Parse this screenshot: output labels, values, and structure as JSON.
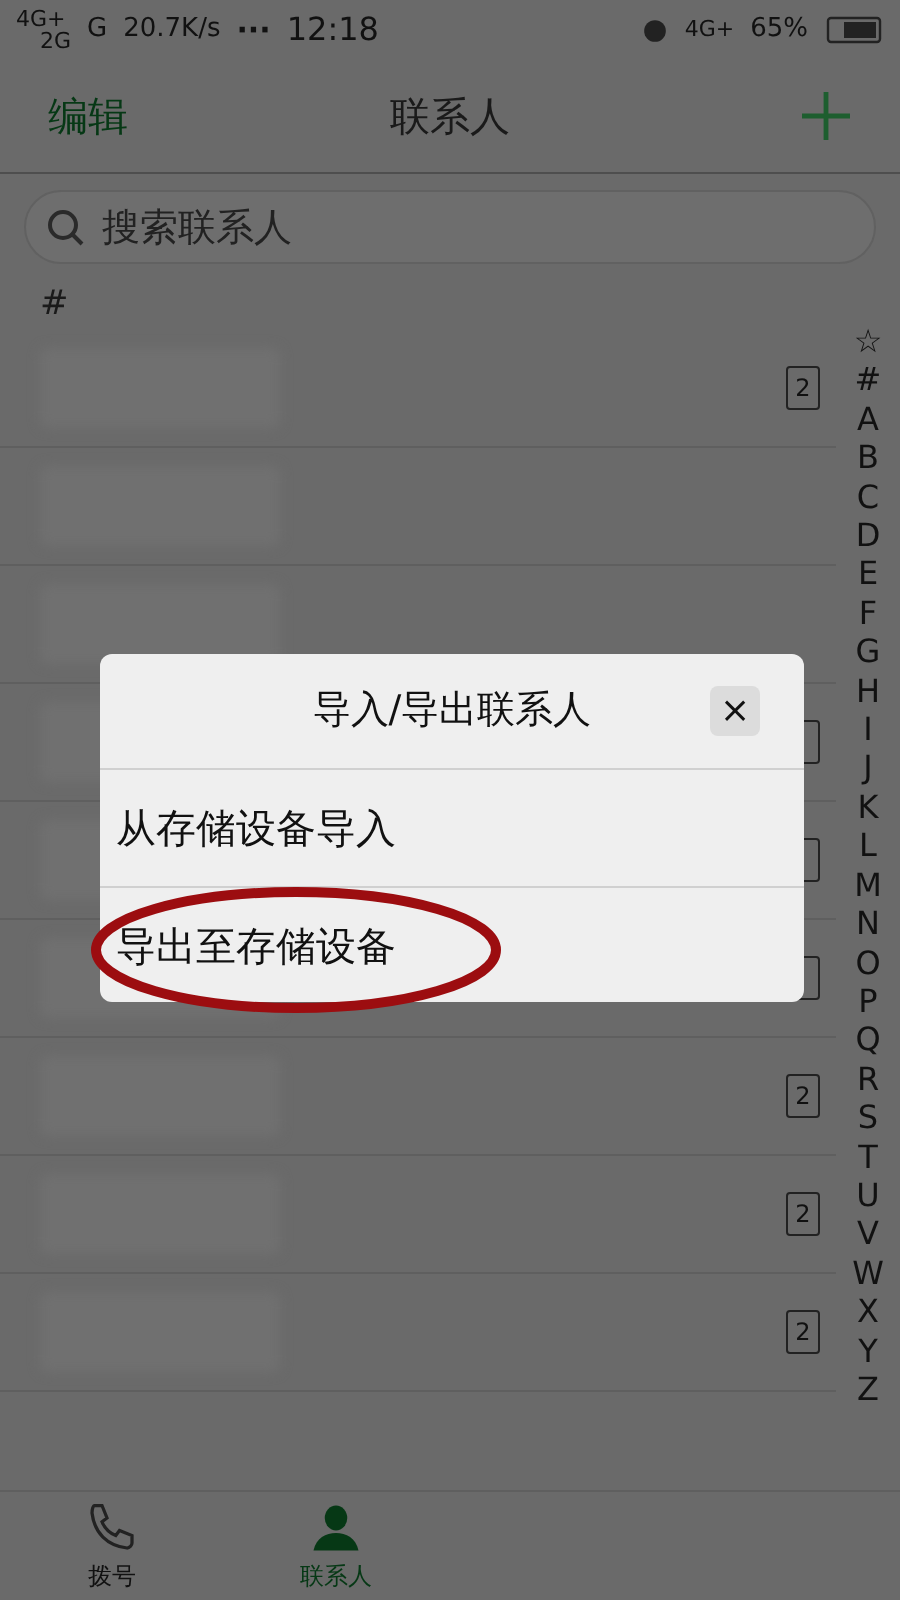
{
  "status_bar": {
    "sim1": "4G+",
    "sim2": "2G",
    "network": "G",
    "speed": "20.7K/s",
    "more": "···",
    "time": "12:18",
    "data": "4G+",
    "battery": "65%"
  },
  "header": {
    "left": "编辑",
    "title": "联系人"
  },
  "search": {
    "placeholder": "搜索联系人"
  },
  "section": "#",
  "contacts": [
    {
      "has_sim": true,
      "sim_slot": "2"
    },
    {
      "has_sim": false
    },
    {
      "has_sim": false
    },
    {
      "has_sim": true
    },
    {
      "has_sim": true
    },
    {
      "has_sim": true
    },
    {
      "has_sim": true,
      "sim_slot": "2"
    },
    {
      "has_sim": true,
      "sim_slot": "2"
    },
    {
      "has_sim": true,
      "sim_slot": "2"
    }
  ],
  "index": [
    "☆",
    "#",
    "A",
    "B",
    "C",
    "D",
    "E",
    "F",
    "G",
    "H",
    "I",
    "J",
    "K",
    "L",
    "M",
    "N",
    "O",
    "P",
    "Q",
    "R",
    "S",
    "T",
    "U",
    "V",
    "W",
    "X",
    "Y",
    "Z"
  ],
  "dialog": {
    "title": "导入/导出联系人",
    "close": "×",
    "options": [
      "从存储设备导入",
      "导出至存储设备"
    ]
  },
  "tabs": [
    {
      "label": "拨号",
      "selected": false,
      "kind": "phone"
    },
    {
      "label": "联系人",
      "selected": true,
      "kind": "person"
    }
  ]
}
